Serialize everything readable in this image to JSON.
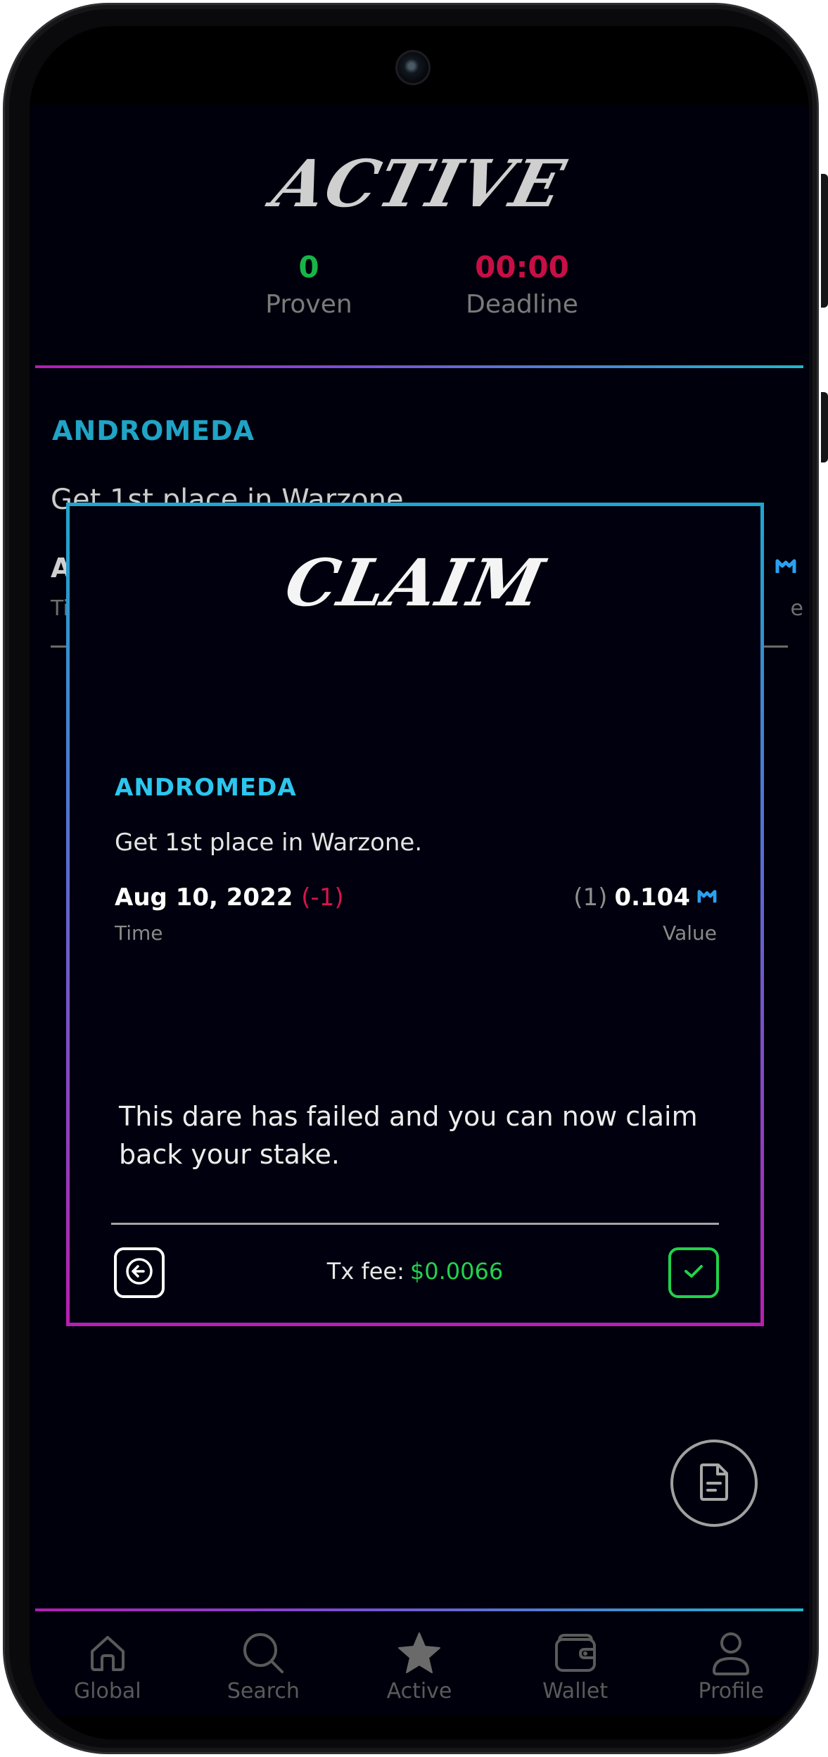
{
  "header": {
    "logo_text": "ACTIVE",
    "proven": {
      "value": "0",
      "label": "Proven",
      "color": "#17b548"
    },
    "deadline": {
      "value": "00:00",
      "label": "Deadline",
      "color": "#c70f45"
    }
  },
  "dare": {
    "title": "ANDROMEDA",
    "description": "Get 1st place in Warzone.",
    "row_left_partial": "A",
    "row_left_label_partial": "Ti",
    "row_right_label_partial": "e"
  },
  "modal": {
    "logo_text": "CLAIM",
    "title": "ANDROMEDA",
    "description": "Get 1st place in Warzone.",
    "date": "Aug 10, 2022",
    "date_offset": "(-1)",
    "time_label": "Time",
    "value_count": "(1)",
    "value_amount": "0.104",
    "value_label": "Value",
    "token_icon": "polygon-matic-icon",
    "message": "This dare has failed and you can now claim back your stake.",
    "tx_fee_label": "Tx fee:",
    "tx_fee_value": "$0.0066",
    "back_icon": "arrow-left-icon",
    "confirm_icon": "check-icon"
  },
  "fab": {
    "icon": "document-icon"
  },
  "nav": {
    "items": [
      {
        "label": "Global",
        "icon": "home-icon"
      },
      {
        "label": "Search",
        "icon": "search-icon"
      },
      {
        "label": "Active",
        "icon": "star-icon"
      },
      {
        "label": "Wallet",
        "icon": "wallet-icon"
      },
      {
        "label": "Profile",
        "icon": "user-icon"
      }
    ]
  },
  "colors": {
    "background": "#00000c",
    "accent_cyan": "#1fa4c6",
    "accent_magenta": "#b21cb5",
    "success": "#22d24e",
    "danger": "#c70f45"
  }
}
